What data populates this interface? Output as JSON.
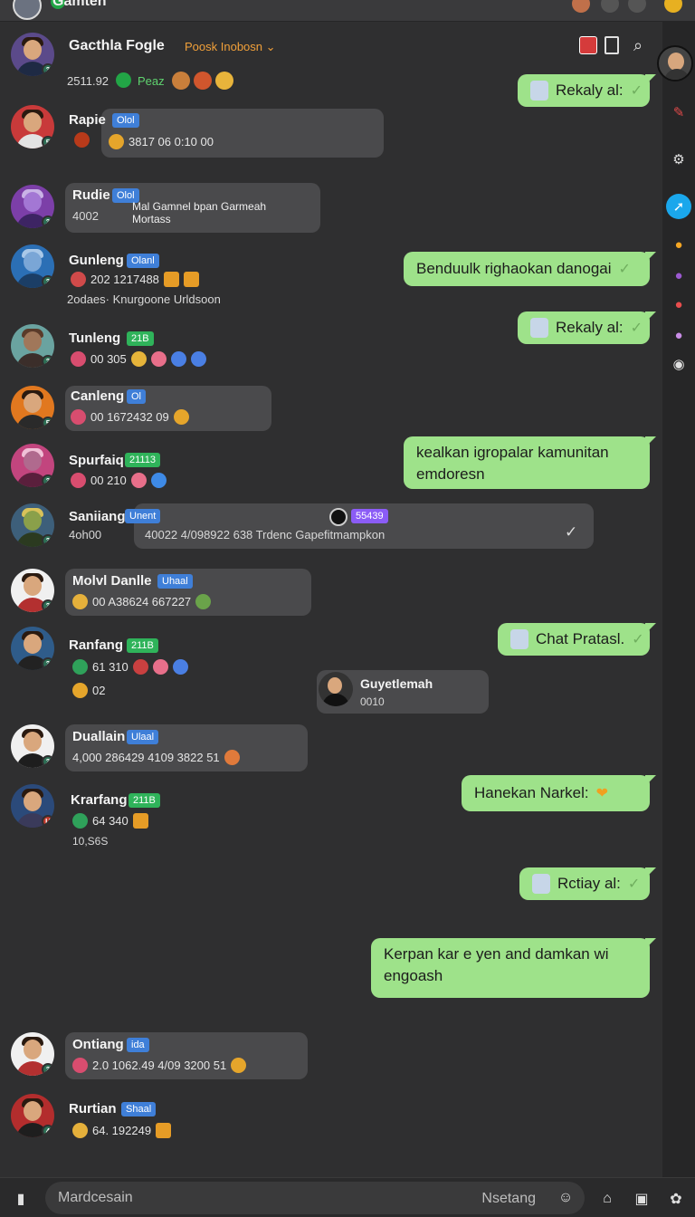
{
  "app": {
    "title": "Gamten"
  },
  "header": {
    "name": "Gacthla Fogle",
    "status": "Poosk Inobosn ⌄",
    "stat": "2511.92",
    "stat2": "Peaz"
  },
  "contacts": [
    {
      "name": "Rapie",
      "tag": "Olol",
      "stats": "3817  06  0:10  00"
    },
    {
      "name": "Rudie",
      "tag": "Olol",
      "stats": "4002",
      "note": "Mal Gamnel bpan Garmeah Mortass"
    },
    {
      "name": "Gunleng",
      "tag": "Olanl",
      "stats": "202  1217488",
      "sub": "2odaes· Knurgoone  Urldsoon"
    },
    {
      "name": "Tunleng",
      "tag": "21B",
      "stats": "00  305"
    },
    {
      "name": "Canleng",
      "tag": "Ol",
      "stats": "00  1672432  09"
    },
    {
      "name": "Spurfaiq",
      "tag": "21113",
      "stats": "00  210"
    },
    {
      "name": "Saniiang",
      "tag": "Unent",
      "stats": "4oh00",
      "wide": "40022 4/098922  638  Trdenc Gapefitmampkon",
      "wide_tag": "55439"
    },
    {
      "name": "Molvl Danlle",
      "tag": "Uhaal",
      "stats": "00  A38624  667227"
    },
    {
      "name": "Ranfang",
      "tag": "211B",
      "stats": "61  310",
      "sub": "02"
    },
    {
      "name": "Duallain",
      "tag": "Ulaal",
      "stats": "4,000  286429  4109 3822  51"
    },
    {
      "name": "Krarfang",
      "tag": "211B",
      "stats": "64  340",
      "sub": "10,S6S"
    },
    {
      "name": "Ontiang",
      "tag": "ida",
      "stats": "2.0  1062.49  4/09 3200  51"
    },
    {
      "name": "Rurtian",
      "tag": "Shaal",
      "stats": "64.  192249"
    }
  ],
  "guest": {
    "name": "Guyetlemah",
    "sub": "0010"
  },
  "outgoing": [
    "Rekaly al:",
    "Benduulk righaokan danogai",
    "Rekaly al:",
    "kealkan igropalar kamunitan emdoresn",
    "Chat Pratasl.",
    "Hanekan Narkel:",
    "Rctiay al:",
    "Kerpan kar e yen and damkan wi engoash"
  ],
  "composer": {
    "placeholder": "Mardcesain",
    "right_label": "Nsetang"
  },
  "colors": {
    "background": "#2f2f30",
    "incoming_bubble": "#4a4a4c",
    "outgoing_bubble": "#9ee28a",
    "accent": "#1aa7ec"
  }
}
